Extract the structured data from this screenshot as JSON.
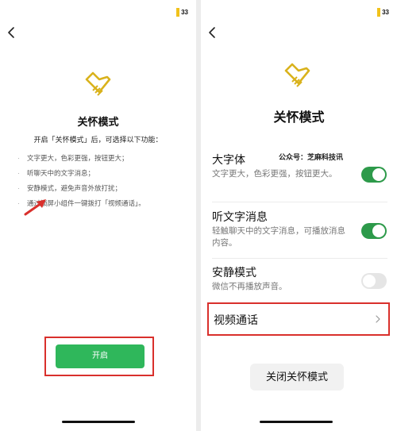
{
  "left_screen": {
    "status_badge": "33",
    "title": "关怀模式",
    "intro": "开启「关怀模式」后，可选择以下功能：",
    "features": [
      "文字更大，色彩更强，按钮更大；",
      "听聊天中的文字消息；",
      "安静模式，避免声音外放打扰；",
      "通过锁屏小组件一键拨打「视频通话」。"
    ],
    "enable_button": "开启"
  },
  "right_screen": {
    "status_badge": "33",
    "title": "关怀模式",
    "watermark": "公众号：芝麻科技讯",
    "settings": [
      {
        "title": "大字体",
        "desc": "文字更大，色彩更强，按钮更大。",
        "enabled": true
      },
      {
        "title": "听文字消息",
        "desc": "轻触聊天中的文字消息，可播放消息内容。",
        "enabled": true
      },
      {
        "title": "安静模式",
        "desc": "微信不再播放声音。",
        "enabled": false
      }
    ],
    "video_call_label": "视频通话",
    "close_button": "关闭关怀模式"
  },
  "colors": {
    "accent_green": "#2fb75b",
    "toggle_green": "#2d9a4a",
    "logo_gold": "#d9b21c",
    "highlight_red": "#d9302c"
  },
  "icons": [
    "back-arrow-icon",
    "care-mode-logo-icon",
    "red-arrow-icon",
    "chevron-right-icon"
  ]
}
